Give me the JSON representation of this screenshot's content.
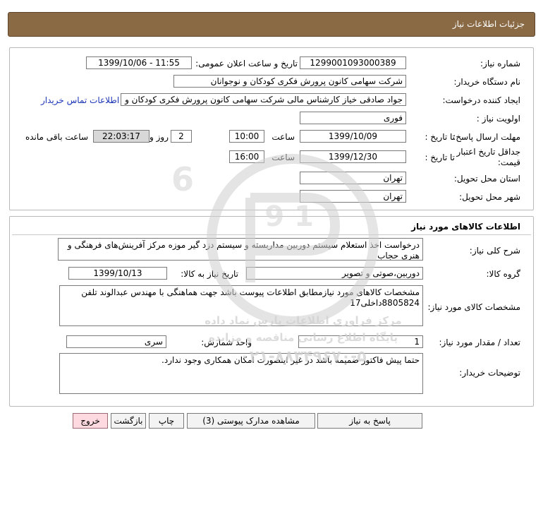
{
  "header": {
    "title": "جزئیات اطلاعات نیاز"
  },
  "info": {
    "need_number": {
      "label": "شماره نیاز:",
      "value": "1299001093000389"
    },
    "announce_datetime": {
      "label": "تاریخ و ساعت اعلان عمومی:",
      "value": "1399/10/06 - 11:55"
    },
    "buyer_org": {
      "label": "نام دستگاه خریدار:",
      "value": "شرکت سهامی کانون پرورش فکری کودکان و نوجوانان"
    },
    "requester": {
      "label": "ایجاد کننده درخواست:",
      "value": "جواد  صادقی خیاز کارشناس مالی شرکت سهامی کانون پرورش فکری کودکان و",
      "contact_link": "اطلاعات تماس خریدار"
    },
    "priority": {
      "label": "اولویت نیاز :",
      "value": "فوری"
    },
    "deadline": {
      "label": "مهلت ارسال پاسخ:",
      "to_date_label": "تا تاریخ :",
      "date": "1399/10/09",
      "time_label": "ساعت",
      "time": "10:00",
      "days": "2",
      "days_label": "روز و",
      "remaining": "22:03:17",
      "remaining_label": "ساعت باقی مانده"
    },
    "validity": {
      "label_line1": "جداقل تاریخ اعتبار",
      "label_line2": "قیمت:",
      "to_date_label": "تا تاریخ :",
      "date": "1399/12/30",
      "time_label": "ساعت",
      "time": "16:00"
    },
    "province": {
      "label": "استان محل تحویل:",
      "value": "تهران"
    },
    "city": {
      "label": "شهر محل تحویل:",
      "value": "تهران"
    }
  },
  "goods": {
    "section_title": "اطلاعات کالاهای مورد نیاز",
    "summary": {
      "label": "شرح کلی نیاز:",
      "value": "درخواست اخذ استعلام سیستم دوربین مداربسته و سیستم دزد گیر موزه مرکز آفرینش‌های فرهنگی و هنری حجاب"
    },
    "group": {
      "label": "گروه کالا:",
      "value": "دوربین،صوتی و تصویر",
      "date_label": "تاریخ نیاز به کالا:",
      "date": "1399/10/13"
    },
    "specs": {
      "label": "مشخصات کالای مورد نیاز:",
      "value": "مشخصات کالاهای مورد نیازمطابق اطلاعات پیوست باشد جهت هماهنگی با مهندس عبدالوند تلفن 8805824داخلی17"
    },
    "quantity": {
      "label": "تعداد / مقدار مورد نیاز:",
      "value": "1",
      "unit_label": "واحد شمارش:",
      "unit": "سری"
    },
    "buyer_notes": {
      "label": "توضیحات خریدار:",
      "value": "حتما پیش فاکتور ضمیمه باشد در غیر اینصورت امکان همکاری وجود ندارد."
    }
  },
  "buttons": {
    "reply": "پاسخ به نیاز",
    "attachments": "مشاهده مدارک پیوستی (3)",
    "print": "چاپ",
    "back": "بازگشت",
    "exit": "خروج"
  },
  "watermark": {
    "line1": "مرکز فراوری اطلاعات پارس نماد داده",
    "line2": "پایگاه اطلاع رسانی مناقصه و مزایده",
    "phone": "۰۲۱-۸۸۳۴۹۶۷۰-۵"
  },
  "colors": {
    "title_bg": "#8a6a45",
    "link": "#1a35b8",
    "exit_bg": "#ffd9e0"
  }
}
